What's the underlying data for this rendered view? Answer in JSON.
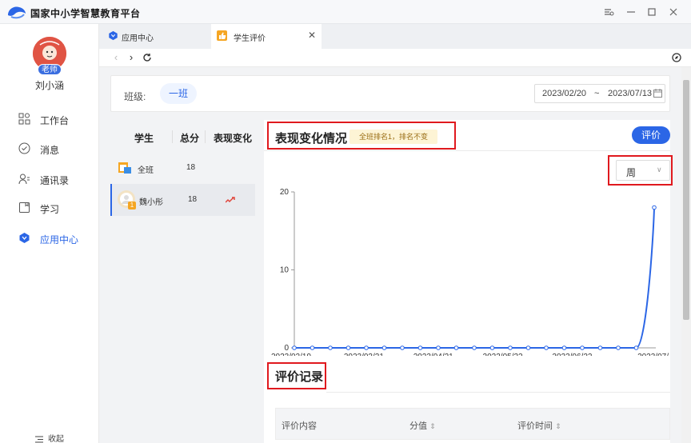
{
  "app": {
    "title": "国家中小学智慧教育平台"
  },
  "window": {
    "controls": [
      "settings-icon",
      "minimize-icon",
      "maximize-icon",
      "close-icon"
    ]
  },
  "user": {
    "name": "刘小涵",
    "role": "老师"
  },
  "sidebar": {
    "items": [
      {
        "label": "工作台",
        "icon": "dashboard-icon"
      },
      {
        "label": "消息",
        "icon": "message-check-icon"
      },
      {
        "label": "通讯录",
        "icon": "contacts-icon"
      },
      {
        "label": "学习",
        "icon": "study-icon"
      },
      {
        "label": "应用中心",
        "icon": "app-center-icon",
        "active": true
      }
    ],
    "collapse_label": "收起"
  },
  "tabs": [
    {
      "label": "应用中心",
      "icon": "app-center-icon"
    },
    {
      "label": "学生评价",
      "icon": "thumbs-up-icon",
      "active": true
    }
  ],
  "filter": {
    "class_label": "班级:",
    "class_value": "一班",
    "date_start": "2023/02/20",
    "date_sep": "~",
    "date_end": "2023/07/13"
  },
  "students": {
    "headers": {
      "student": "学生",
      "total": "总分",
      "trend": "表现变化"
    },
    "rows": [
      {
        "name": "全班",
        "score": "18"
      },
      {
        "name": "魏小彤",
        "score": "18",
        "rank_badge": "1",
        "selected": true
      }
    ]
  },
  "performance": {
    "title": "表现变化情况",
    "rank_tag": "全班排名1，排名不变",
    "evaluate_button": "评价",
    "period_value": "周"
  },
  "chart_data": {
    "type": "line",
    "x_tick_labels": [
      "2023/02/19",
      "2023/03/21",
      "2023/04/21",
      "2023/05/22",
      "2023/06/22",
      "2023/07/"
    ],
    "y_ticks": [
      0,
      10,
      20
    ],
    "ylim": [
      0,
      20
    ],
    "series": [
      {
        "values": [
          0,
          0,
          0,
          0,
          0,
          0,
          0,
          0,
          0,
          0,
          0,
          0,
          0,
          0,
          0,
          0,
          0,
          0,
          0,
          0,
          18
        ]
      }
    ],
    "color": "#2b66e6"
  },
  "records": {
    "title": "评价记录",
    "columns": [
      "评价内容",
      "分值",
      "评价时间"
    ]
  }
}
